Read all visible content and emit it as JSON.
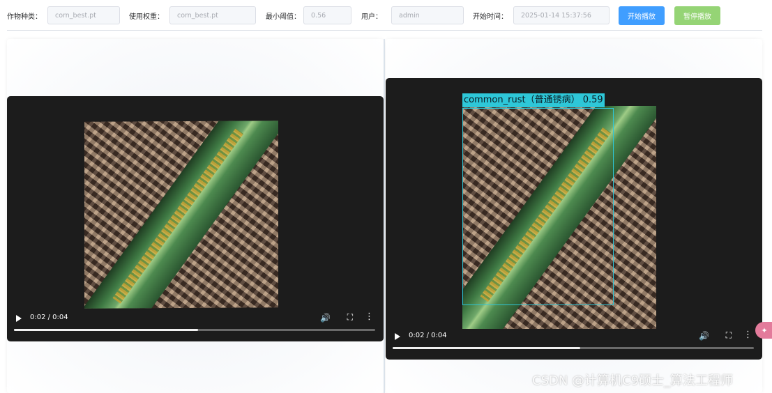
{
  "toolbar": {
    "crop_label": "作物种类：",
    "crop_value": "corn_best.pt",
    "model_label": "使用权重：",
    "model_value": "corn_best.pt",
    "threshold_label": "最小阈值：",
    "threshold_value": "0.56",
    "user_label": "用户：",
    "user_value": "admin",
    "start_time_label": "开始时间：",
    "start_time_value": "2025-01-14 15:37:56",
    "start_button": "开始播放",
    "pause_button": "暂停播放"
  },
  "left_video": {
    "time": "0:02 / 0:04",
    "progress": 0.51
  },
  "right_video": {
    "detection_label": "common_rust（普通锈病） 0.59",
    "time": "0:02 / 0:04",
    "progress": 0.52
  },
  "watermark": "CSDN @计算机C9硕士_算法工程师",
  "icons": {
    "play": "play-icon",
    "volume": "volume-icon",
    "fullscreen": "fullscreen-icon",
    "more": "more-vertical-icon",
    "badge": "plugin-badge-icon"
  },
  "colors": {
    "primary": "#409eff",
    "success": "#95d475",
    "bbox": "#2ec7d8"
  }
}
